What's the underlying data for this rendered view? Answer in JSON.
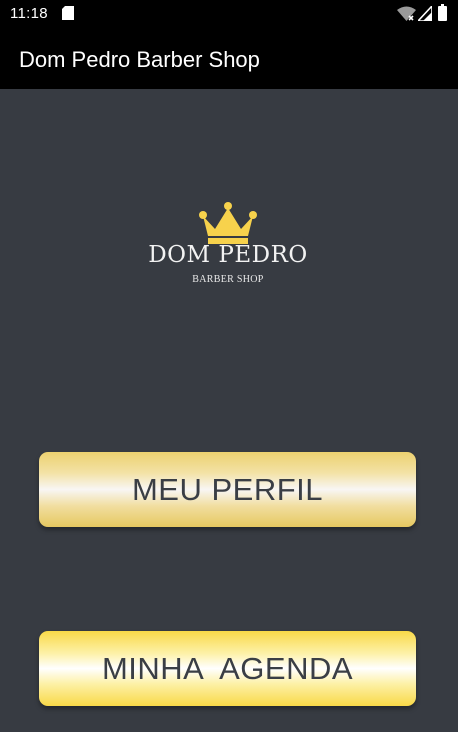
{
  "status_bar": {
    "time": "11:18",
    "icons": [
      "sd-card-icon",
      "wifi-icon",
      "signal-icon",
      "battery-icon"
    ]
  },
  "app_bar": {
    "title": "Dom Pedro Barber Shop"
  },
  "logo": {
    "name": "DOM PEDRO",
    "subtitle": "BARBER SHOP",
    "crown_color": "#f7d24c"
  },
  "buttons": {
    "meu_perfil": "MEU PERFIL",
    "minha_agenda": "MINHA  AGENDA"
  },
  "colors": {
    "background": "#373b42",
    "app_bar": "#000000",
    "button_text": "#3a3e45",
    "gold": "#f7d24c"
  }
}
